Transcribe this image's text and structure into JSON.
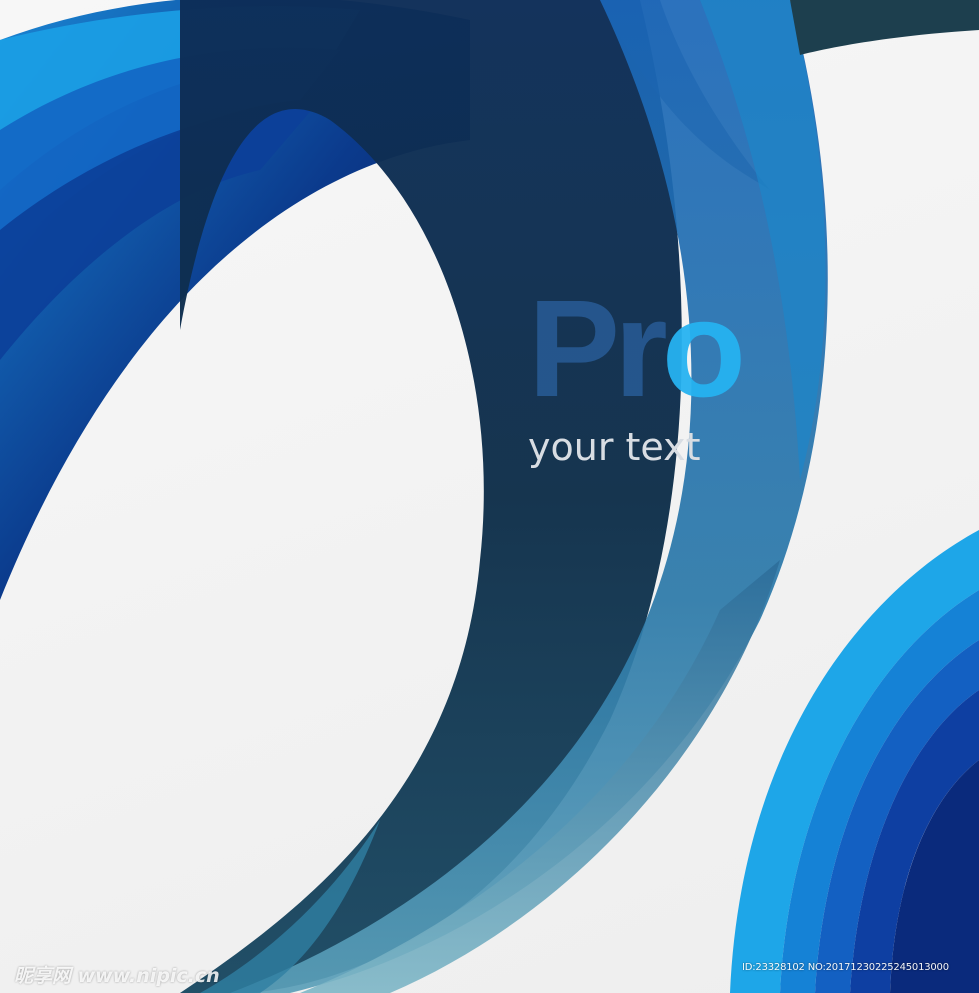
{
  "poster": {
    "headline_part1": "Pr",
    "headline_part2": "o",
    "tagline": "your text"
  },
  "watermark": {
    "site": "昵享网 www.nipic.cn",
    "id_line": "ID:23328102 NO:20171230225245013000"
  },
  "colors": {
    "background": "#f1f1f1",
    "dark_navy": "#0e2a4e",
    "royal_blue": "#1346a0",
    "sky_blue": "#1ea6e8",
    "teal": "#2f7fa3",
    "headline_dark": "#285c96",
    "headline_accent": "#26b2f0"
  }
}
